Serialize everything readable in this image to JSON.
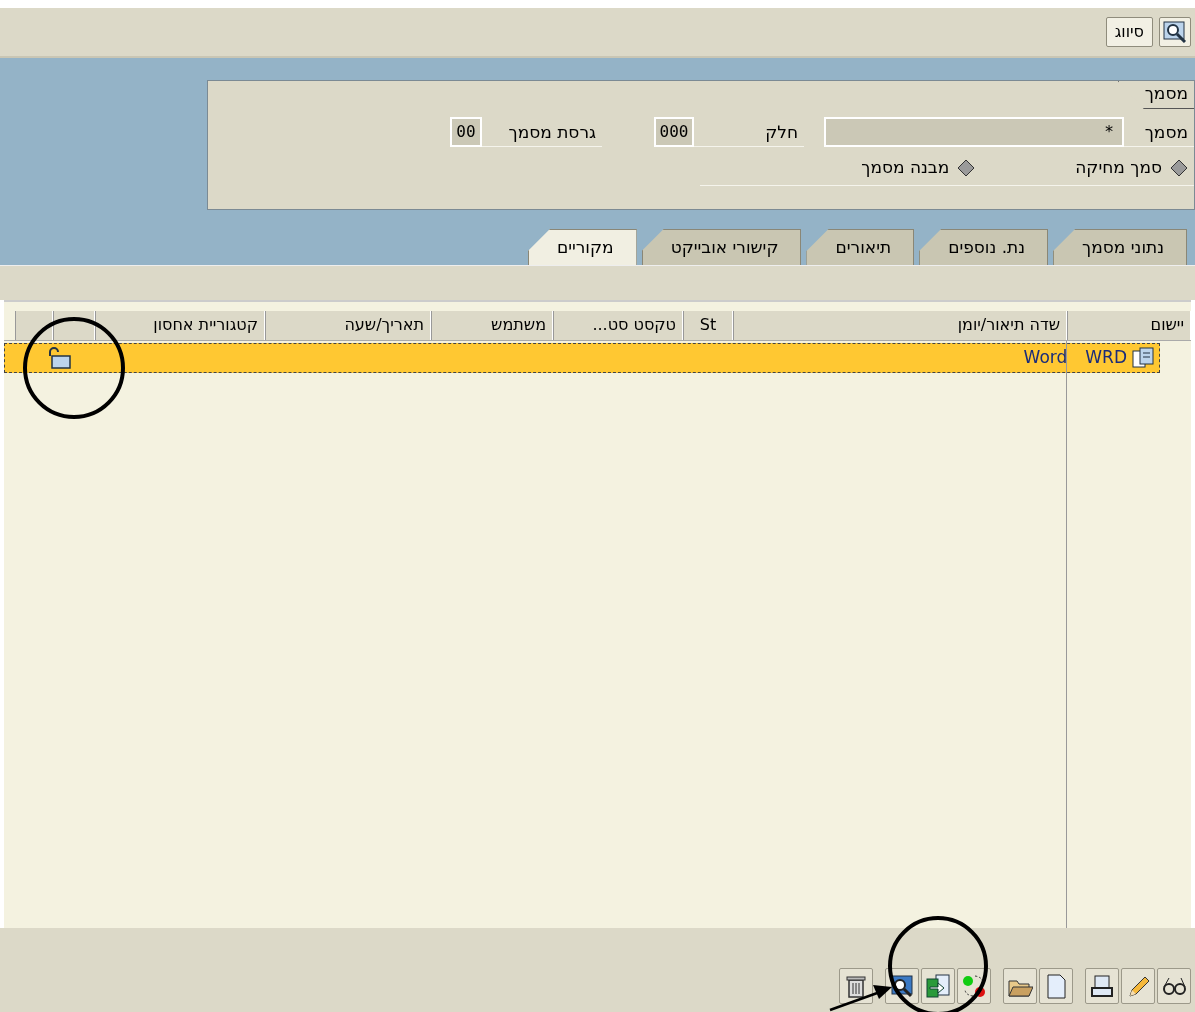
{
  "toolbar": {
    "button": "סיווג"
  },
  "document_panel": {
    "tab": "מסמך",
    "fields": [
      {
        "label": "מסמך",
        "value": "*"
      },
      {
        "label": "חלק",
        "value": "000"
      },
      {
        "label": "גרסת מסמך",
        "value": "00"
      }
    ],
    "links": [
      "סמך מחיקה",
      "מבנה מסמך"
    ]
  },
  "tabs": [
    {
      "label": "נתוני מסמך",
      "selected": false
    },
    {
      "label": "נת. נוספים",
      "selected": false
    },
    {
      "label": "תיאורים",
      "selected": false
    },
    {
      "label": "קישורי אובייקט",
      "selected": false
    },
    {
      "label": "מקוריים",
      "selected": true
    }
  ],
  "table": {
    "columns": [
      "יישום",
      "שדה תיאור/יומן",
      "St",
      "טקסט סט...",
      "משתמש",
      "תאריך/שעה",
      "קטגוריית אחסון"
    ],
    "rows": [
      {
        "selected": true,
        "application": "WRD",
        "description": "Word"
      }
    ]
  }
}
